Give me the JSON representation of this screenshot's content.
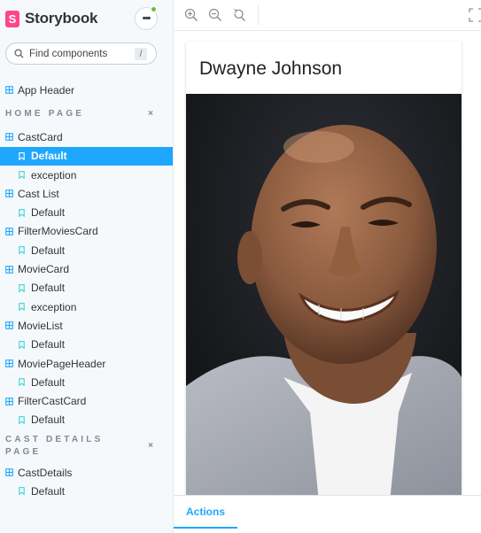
{
  "brand": {
    "logo_letter": "S",
    "name": "Storybook"
  },
  "menu": {
    "label": "•••",
    "status_color": "#66bf3c"
  },
  "search": {
    "placeholder": "Find components",
    "shortcut": "/"
  },
  "sidebar": {
    "ungrouped": [
      {
        "label": "App Header"
      }
    ],
    "sections": [
      {
        "title": "HOME PAGE",
        "collapse_label": "×",
        "components": [
          {
            "label": "CastCard",
            "stories": [
              {
                "label": "Default",
                "selected": true
              },
              {
                "label": "exception"
              }
            ]
          },
          {
            "label": "Cast List",
            "stories": [
              {
                "label": "Default"
              }
            ]
          },
          {
            "label": "FilterMoviesCard",
            "stories": [
              {
                "label": "Default"
              }
            ]
          },
          {
            "label": "MovieCard",
            "stories": [
              {
                "label": "Default"
              },
              {
                "label": "exception"
              }
            ]
          },
          {
            "label": "MovieList",
            "stories": [
              {
                "label": "Default"
              }
            ]
          },
          {
            "label": "MoviePageHeader",
            "stories": [
              {
                "label": "Default"
              }
            ]
          },
          {
            "label": "FilterCastCard",
            "stories": [
              {
                "label": "Default"
              }
            ]
          }
        ]
      },
      {
        "title": "CAST DETAILS PAGE",
        "collapse_label": "×",
        "components": [
          {
            "label": "CastDetails",
            "stories": [
              {
                "label": "Default"
              }
            ]
          }
        ]
      }
    ]
  },
  "toolbar": {
    "zoom_in_icon": "zoom-in-icon",
    "zoom_out_icon": "zoom-out-icon",
    "zoom_reset_icon": "zoom-reset-icon",
    "fullscreen_icon": "fullscreen-icon"
  },
  "preview": {
    "card_title": "Dwayne Johnson",
    "image_subject": "portrait photo"
  },
  "addons": {
    "tabs": [
      {
        "label": "Actions",
        "active": true
      }
    ]
  },
  "colors": {
    "accent": "#1ea7fd",
    "brand": "#ff4785"
  }
}
